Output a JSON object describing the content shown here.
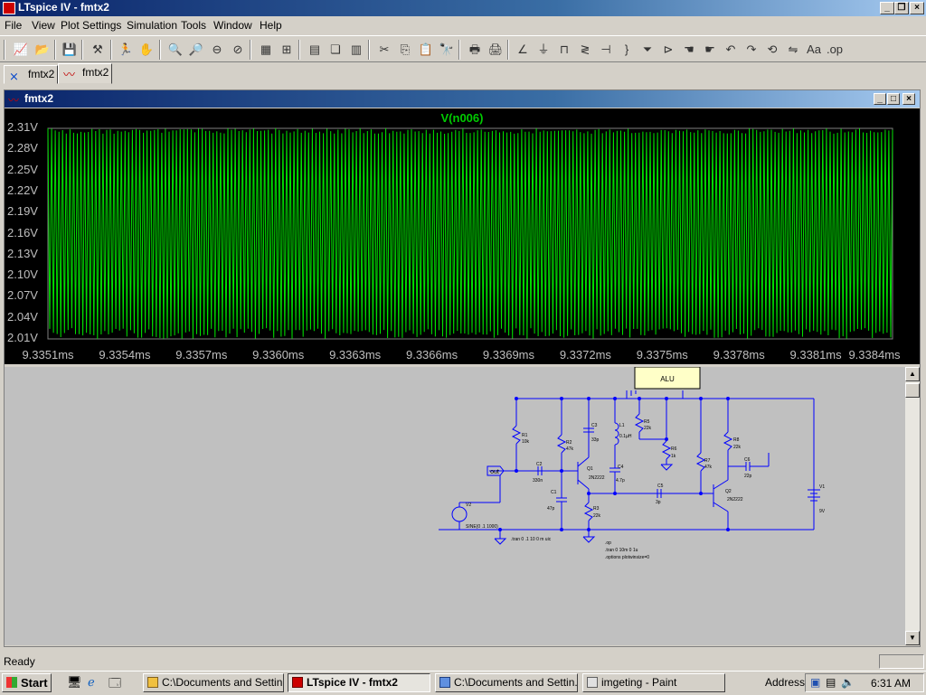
{
  "window": {
    "title": "LTspice IV - fmtx2"
  },
  "menu": [
    "File",
    "View",
    "Plot Settings",
    "Simulation",
    "Tools",
    "Window",
    "Help"
  ],
  "tabs": [
    {
      "label": "fmtx2",
      "icon": "schematic-icon"
    },
    {
      "label": "fmtx2",
      "icon": "waveform-icon"
    }
  ],
  "plot_window": {
    "title": "fmtx2"
  },
  "chart_data": {
    "type": "line",
    "title": "V(n006)",
    "trace_color": "#00e000",
    "background": "#000000",
    "y_ticks": [
      "2.31V",
      "2.28V",
      "2.25V",
      "2.22V",
      "2.19V",
      "2.16V",
      "2.13V",
      "2.10V",
      "2.07V",
      "2.04V",
      "2.01V"
    ],
    "x_ticks": [
      "9.3351ms",
      "9.3354ms",
      "9.3357ms",
      "9.3360ms",
      "9.3363ms",
      "9.3366ms",
      "9.3369ms",
      "9.3372ms",
      "9.3375ms",
      "9.3378ms",
      "9.3381ms",
      "9.3384ms"
    ],
    "xlim_ms": [
      9.3351,
      9.3384
    ],
    "ylim_V": [
      2.01,
      2.31
    ],
    "waveform": "dense oscillation spanning full range"
  },
  "schematic": {
    "labels": {
      "ic": "ALU",
      "out": "out",
      "r1": "R1",
      "r1v": "10k",
      "c2": "C2",
      "c2v": "330n",
      "r2": "R2",
      "r2v": "47k",
      "c1": "C1",
      "c1v": "47p",
      "q1": "Q1",
      "q1m": "2N2222",
      "r3": "R3",
      "r3v": "22k",
      "c3": "C3",
      "c3v": "33p",
      "c4": "C4",
      "c4v": "4.7p",
      "l1": "L1",
      "l1v": "0.1µH",
      "r5": "R5",
      "r5v": "22k",
      "r6": "R6",
      "r6v": "1k",
      "r7": "R7",
      "r7v": "47k",
      "c5": "C5",
      "c5v": "3p",
      "r8": "R8",
      "r8v": "22k",
      "c6": "C6",
      "c6v": "22p",
      "q2": "Q2",
      "q2m": "2N2222",
      "v1": "V1",
      "v1v": "9V",
      "v2": "V2",
      "sine": "SINE(0 .1 1000)",
      "tran_left": ".tran 0 .1 10 0 m uic",
      "dir1": ".op",
      "dir2": ".tran 0 10m 0 1u",
      "dir3": ".options plotwinsize=0"
    }
  },
  "status": {
    "text": "Ready"
  },
  "taskbar": {
    "start": "Start",
    "tasks": [
      "C:\\Documents and Settin...",
      "LTspice IV - fmtx2",
      "C:\\Documents and Settin...",
      "imgeting - Paint"
    ],
    "address_label": "Address",
    "clock": "6:31 AM"
  }
}
